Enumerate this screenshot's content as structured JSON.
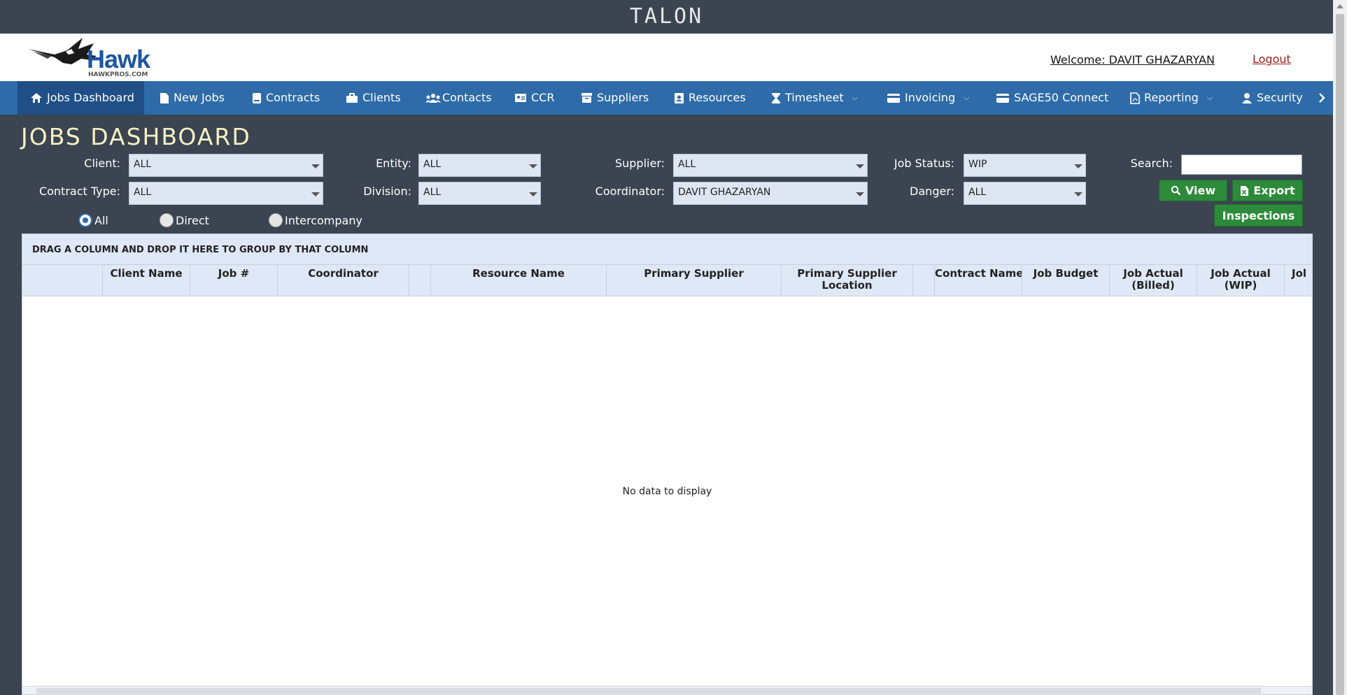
{
  "app": {
    "title": "TALON"
  },
  "header": {
    "logo_text": "Hawk",
    "logo_subtext": "HAWKPROS.COM",
    "welcome": "Welcome: DAVIT GHAZARYAN",
    "logout": "Logout"
  },
  "nav": {
    "items": [
      {
        "label": "Jobs Dashboard",
        "icon": "home-icon",
        "active": true
      },
      {
        "label": "New Jobs",
        "icon": "document-icon"
      },
      {
        "label": "Contracts",
        "icon": "book-icon"
      },
      {
        "label": "Clients",
        "icon": "briefcase-icon"
      },
      {
        "label": "Contacts",
        "icon": "users-icon"
      },
      {
        "label": "CCR",
        "icon": "id-card-icon"
      },
      {
        "label": "Suppliers",
        "icon": "archive-icon"
      },
      {
        "label": "Resources",
        "icon": "contact-book-icon"
      },
      {
        "label": "Timesheet",
        "icon": "hourglass-icon",
        "dropdown": true
      },
      {
        "label": "Invoicing",
        "icon": "credit-card-icon",
        "dropdown": true
      },
      {
        "label": "SAGE50 Connect",
        "icon": "credit-card-icon"
      },
      {
        "label": "Reporting",
        "icon": "pdf-file-icon",
        "dropdown": true
      },
      {
        "label": "Security",
        "icon": "user-icon"
      }
    ]
  },
  "page": {
    "title": "JOBS DASHBOARD"
  },
  "filters": {
    "client": {
      "label": "Client:",
      "value": "ALL"
    },
    "contract_type": {
      "label": "Contract Type:",
      "value": "ALL"
    },
    "entity": {
      "label": "Entity:",
      "value": "ALL"
    },
    "division": {
      "label": "Division:",
      "value": "ALL"
    },
    "supplier": {
      "label": "Supplier:",
      "value": "ALL"
    },
    "coordinator": {
      "label": "Coordinator:",
      "value": "DAVIT GHAZARYAN"
    },
    "job_status": {
      "label": "Job Status:",
      "value": "WIP"
    },
    "danger": {
      "label": "Danger:",
      "value": "ALL"
    },
    "search": {
      "label": "Search:",
      "value": ""
    }
  },
  "buttons": {
    "view": "View",
    "export": "Export",
    "inspections": "Inspections"
  },
  "radios": [
    {
      "label": "All",
      "checked": true
    },
    {
      "label": "Direct",
      "checked": false
    },
    {
      "label": "Intercompany",
      "checked": false
    }
  ],
  "grid": {
    "group_panel": "DRAG A COLUMN AND DROP IT HERE TO GROUP BY THAT COLUMN",
    "columns": [
      "",
      "Client Name",
      "Job #",
      "Coordinator",
      "",
      "Resource Name",
      "Primary Supplier",
      "Primary Supplier\nLocation",
      "",
      "Contract Name",
      "Job Budget",
      "Job Actual\n(Billed)",
      "Job Actual\n(WIP)",
      "Jol"
    ],
    "empty": "No data to display"
  },
  "colors": {
    "nav_bg": "#2e6ba8",
    "nav_active": "#1f4f86",
    "page_bg": "#3b4450",
    "title_color": "#f3f1c5",
    "button_green": "#2c8a3a"
  }
}
